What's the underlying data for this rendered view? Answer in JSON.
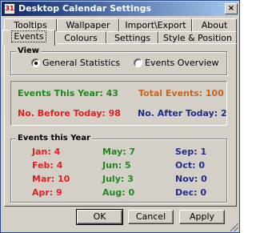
{
  "window": {
    "title": "Desktop Calendar Settings",
    "close_glyph": "×",
    "icon": "calendar-icon"
  },
  "tabs": {
    "row1": [
      "Tooltips",
      "Wallpaper",
      "Import\\Export",
      "About"
    ],
    "row2": [
      "Events",
      "Colours",
      "Settings",
      "Style & Position"
    ],
    "active": "Events"
  },
  "view": {
    "legend": "View",
    "options": [
      "General Statistics",
      "Events Overview"
    ],
    "selected": "General Statistics"
  },
  "stats": {
    "events_this_year": "Events This Year: 43",
    "total_events": "Total Events: 100",
    "before_today": "No. Before Today: 98",
    "after_today": "No. After Today: 2"
  },
  "months": {
    "legend": "Events this Year",
    "columns": [
      [
        "Jan: 4",
        "Feb: 4",
        "Mar: 10",
        "Apr: 9"
      ],
      [
        "May: 7",
        "Jun: 5",
        "July: 3",
        "Aug: 0"
      ],
      [
        "Sep: 1",
        "Oct: 0",
        "Nov: 0",
        "Dec: 0"
      ]
    ]
  },
  "buttons": {
    "ok": "OK",
    "cancel": "Cancel",
    "apply": "Apply"
  },
  "colors": {
    "title_bar": "#0a246a",
    "green": "#1a8a1a",
    "orange": "#c8641e",
    "red": "#e61e1e",
    "navy": "#1e2d8c",
    "face": "#d4d0c8"
  }
}
